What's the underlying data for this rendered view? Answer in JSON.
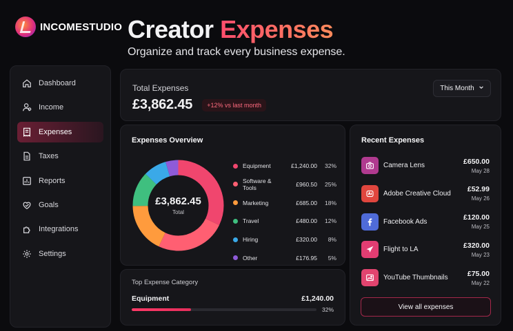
{
  "brand": {
    "name": "INCOMESTUDIO"
  },
  "hero": {
    "title_part1": "Creator",
    "title_part2": "Expenses",
    "subtitle": "Organize and track every business expense."
  },
  "sidebar": {
    "items": [
      {
        "label": "Dashboard",
        "icon": "home-icon"
      },
      {
        "label": "Income",
        "icon": "coins-icon"
      },
      {
        "label": "Expenses",
        "icon": "receipt-icon",
        "active": true
      },
      {
        "label": "Taxes",
        "icon": "document-icon"
      },
      {
        "label": "Reports",
        "icon": "chart-icon"
      },
      {
        "label": "Goals",
        "icon": "target-icon"
      },
      {
        "label": "Integrations",
        "icon": "puzzle-icon"
      },
      {
        "label": "Settings",
        "icon": "gear-icon"
      }
    ]
  },
  "total": {
    "label": "Total Expenses",
    "value": "£3,862.45",
    "badge": "+12% vs last month",
    "period": "This Month"
  },
  "overview": {
    "title": "Expenses Overview",
    "center_value": "£3,862.45",
    "center_label": "Total"
  },
  "chart_data": {
    "type": "pie",
    "style": "donut",
    "categories": [
      "Equipment",
      "Software & Tools",
      "Marketing",
      "Travel",
      "Hiring",
      "Other"
    ],
    "values": [
      1240.0,
      960.5,
      685.0,
      480.0,
      320.0,
      176.95
    ],
    "amount_labels": [
      "£1,240.00",
      "£960.50",
      "£685.00",
      "£480.00",
      "£320.00",
      "£176.95"
    ],
    "percent_labels": [
      "32%",
      "25%",
      "18%",
      "12%",
      "8%",
      "5%"
    ],
    "colors": [
      "#f0466e",
      "#ff5f72",
      "#ff9b3d",
      "#3fbf7f",
      "#3aa9e8",
      "#8e5bd8"
    ]
  },
  "top_category": {
    "label": "Top Expense Category",
    "name": "Equipment",
    "amount": "£1,240.00",
    "percent": "32%",
    "fraction": 0.32
  },
  "recent": {
    "title": "Recent Expenses",
    "items": [
      {
        "name": "Camera Lens",
        "amount": "£650.00",
        "date": "May 28",
        "icon": "camera-icon",
        "color": "#b03a8f"
      },
      {
        "name": "Adobe Creative Cloud",
        "amount": "£52.99",
        "date": "May 26",
        "icon": "cloud-icon",
        "color": "#e0463e"
      },
      {
        "name": "Facebook Ads",
        "amount": "£120.00",
        "date": "May 25",
        "icon": "facebook-icon",
        "color": "#4f6bd8"
      },
      {
        "name": "Flight to LA",
        "amount": "£320.00",
        "date": "May 23",
        "icon": "plane-icon",
        "color": "#e23d72"
      },
      {
        "name": "YouTube Thumbnails",
        "amount": "£75.00",
        "date": "May 22",
        "icon": "image-icon",
        "color": "#e2446f"
      }
    ],
    "view_all": "View all expenses"
  }
}
